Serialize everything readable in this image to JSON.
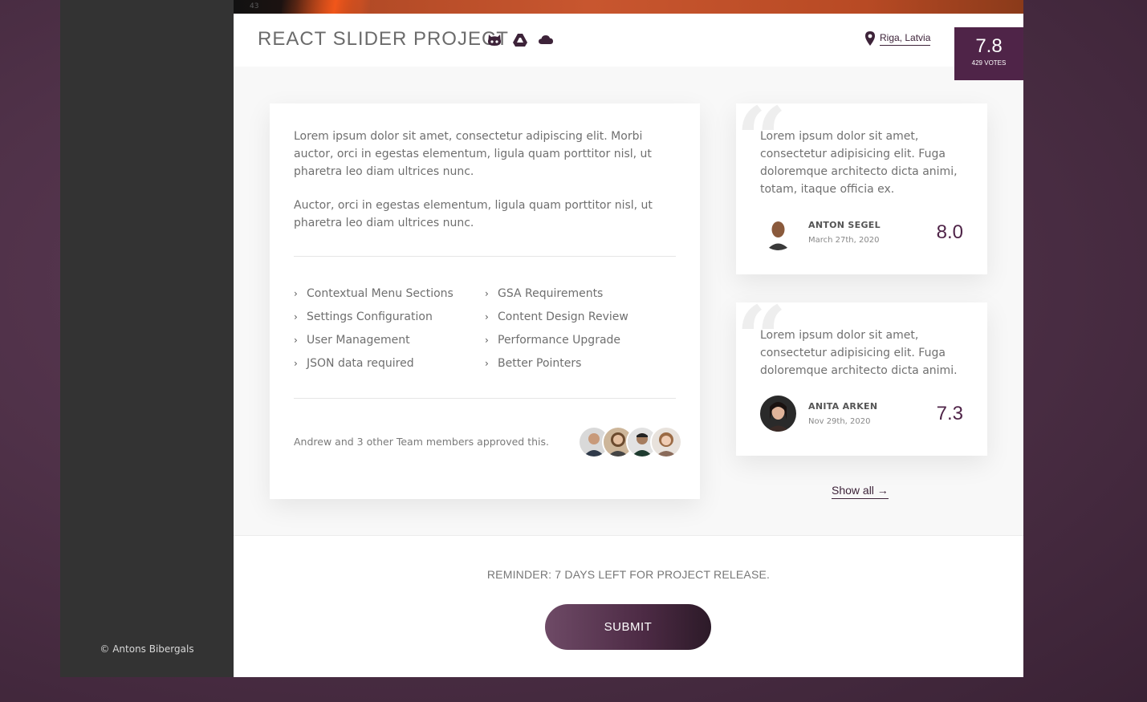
{
  "sidebar": {
    "copyright": "© Antons Bibergals"
  },
  "hero": {
    "number": "43"
  },
  "header": {
    "title": "REACT SLIDER PROJECT",
    "icons": [
      "github-icon",
      "google-drive-icon",
      "cloud-icon"
    ],
    "location": "Riga, Latvia",
    "score": "7.8",
    "votes": "429 VOTES"
  },
  "main": {
    "paragraph1": "Lorem ipsum dolor sit amet, consectetur adipiscing elit. Morbi auctor, orci in egestas elementum, ligula quam porttitor nisl, ut pharetra leo diam ultrices nunc.",
    "paragraph2": "Auctor, orci in egestas elementum, ligula quam porttitor nisl, ut pharetra leo diam ultrices nunc.",
    "features_left": [
      "Contextual Menu Sections",
      "Settings Configuration",
      "User Management",
      "JSON data required"
    ],
    "features_right": [
      "GSA Requirements",
      "Content Design Review",
      "Performance Upgrade",
      "Better Pointers"
    ],
    "approved_text": "Andrew and 3 other Team members approved this."
  },
  "reviews": [
    {
      "text": "Lorem ipsum dolor sit amet, consectetur adipisicing elit. Fuga doloremque architecto dicta animi, totam, itaque officia ex.",
      "name": "ANTON SEGEL",
      "date": "March 27th, 2020",
      "score": "8.0"
    },
    {
      "text": "Lorem ipsum dolor sit amet, consectetur adipisicing elit. Fuga doloremque architecto dicta animi.",
      "name": "ANITA ARKEN",
      "date": "Nov 29th, 2020",
      "score": "7.3"
    }
  ],
  "show_all": "Show all →",
  "footer": {
    "reminder": "REMINDER: 7 DAYS LEFT FOR PROJECT RELEASE.",
    "submit_label": "SUBMIT"
  },
  "colors": {
    "accent": "#4f2448",
    "background": "#4f3148",
    "sidebar": "#333333"
  }
}
